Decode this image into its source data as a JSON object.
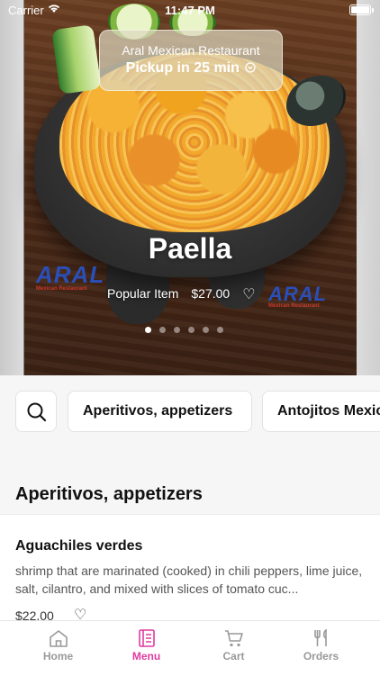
{
  "status_bar": {
    "carrier": "Carrier",
    "time": "11:47 PM"
  },
  "pickup": {
    "restaurant": "Aral Mexican Restaurant",
    "eta": "Pickup in 25 min"
  },
  "hero": {
    "title": "Paella",
    "badge": "Popular Item",
    "price": "$27.00",
    "logo_text": "ARAL",
    "logo_sub": "Mexican Restaurant",
    "carousel_count": 6,
    "carousel_active": 1
  },
  "categories": [
    "Aperitivos, appetizers",
    "Antojitos Mexicanos"
  ],
  "section": {
    "title": "Aperitivos, appetizers"
  },
  "item": {
    "name": "Aguachiles verdes",
    "description": "shrimp that are marinated (cooked) in chili peppers, lime juice, salt, cilantro, and mixed with slices of tomato cuc...",
    "price": "$22.00"
  },
  "tabs": [
    {
      "label": "Home",
      "icon": "home-icon"
    },
    {
      "label": "Menu",
      "icon": "menu-icon"
    },
    {
      "label": "Cart",
      "icon": "cart-icon"
    },
    {
      "label": "Orders",
      "icon": "orders-icon"
    }
  ],
  "colors": {
    "accent": "#e23aa0",
    "inactive": "#999999"
  }
}
